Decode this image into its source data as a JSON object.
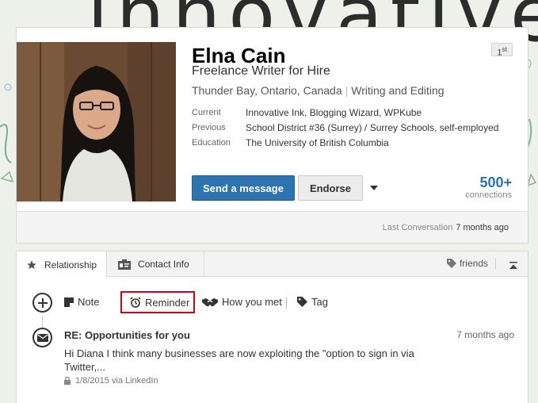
{
  "banner": {
    "text": "innovative"
  },
  "profile": {
    "name": "Elna Cain",
    "degree": "1",
    "degree_suffix": "st",
    "headline": "Freelance Writer for Hire",
    "location": "Thunder Bay, Ontario, Canada",
    "industry": "Writing and Editing",
    "details": [
      {
        "label": "Current",
        "value": "Innovative Ink, Blogging Wizard, WPKube"
      },
      {
        "label": "Previous",
        "value": "School District #36 (Surrey) / Surrey Schools, self-employed"
      },
      {
        "label": "Education",
        "value": "The University of British Columbia"
      }
    ],
    "send_message_label": "Send a message",
    "endorse_label": "Endorse",
    "connections_count": "500+",
    "connections_label": "connections",
    "last_conversation_label": "Last Conversation",
    "last_conversation_ago": "7 months ago"
  },
  "relationship": {
    "tabs": [
      {
        "label": "Relationship",
        "icon": "star-icon"
      },
      {
        "label": "Contact Info",
        "icon": "contact-card-icon"
      }
    ],
    "friends_label": "friends",
    "actions": {
      "note": "Note",
      "reminder": "Reminder",
      "how_you_met": "How you met",
      "tag": "Tag"
    },
    "message": {
      "subject": "RE: Opportunities for you",
      "time": "7 months ago",
      "body": "Hi Diana I think many businesses are now exploiting the \"option to sign in via Twitter,...",
      "meta": "1/8/2015 via LinkedIn"
    }
  },
  "colors": {
    "primary_button": "#2d73b0",
    "highlight_border": "#d0021b"
  }
}
